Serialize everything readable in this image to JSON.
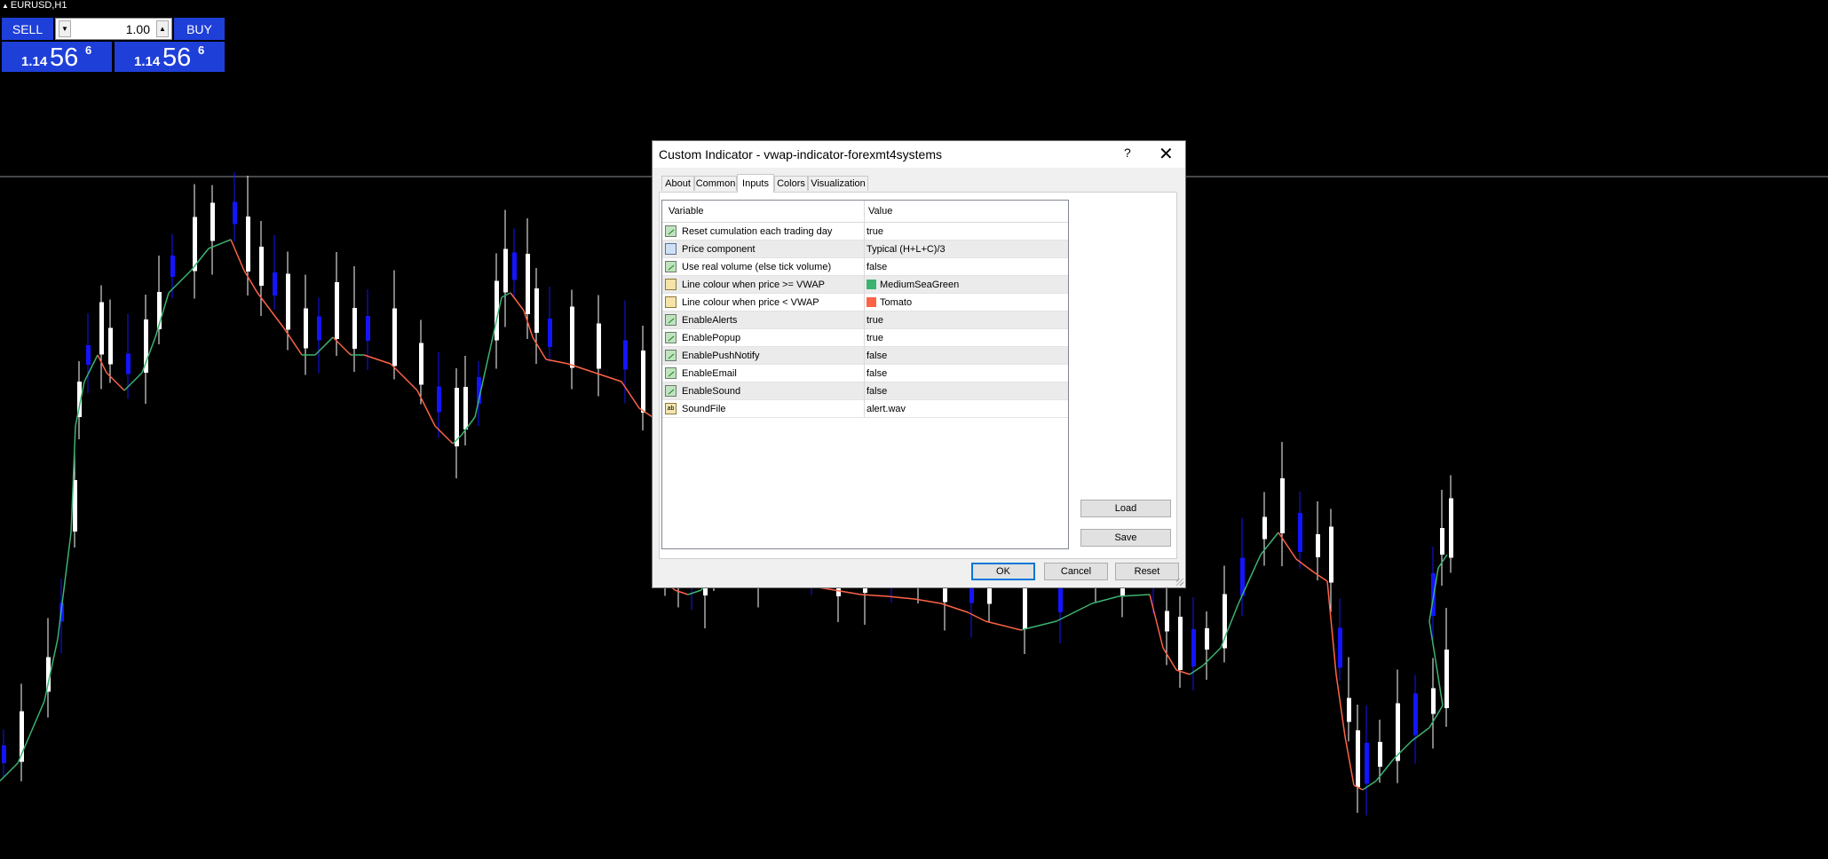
{
  "window": {
    "symbol": "EURUSD,H1"
  },
  "trade_panel": {
    "sell_label": "SELL",
    "buy_label": "BUY",
    "lot_value": "1.00",
    "sell_quote": {
      "small": "1.14",
      "big": "56",
      "sup": "6"
    },
    "buy_quote": {
      "small": "1.14",
      "big": "56",
      "sup": "6"
    }
  },
  "dialog": {
    "title": "Custom Indicator - vwap-indicator-forexmt4systems",
    "help_label": "?",
    "close_label": "✕",
    "tabs": [
      {
        "label": "About"
      },
      {
        "label": "Common"
      },
      {
        "label": "Inputs"
      },
      {
        "label": "Colors"
      },
      {
        "label": "Visualization"
      }
    ],
    "active_tab": "Inputs",
    "columns": {
      "variable": "Variable",
      "value": "Value"
    },
    "rows": [
      {
        "icon": "bool-icon",
        "name": "Reset cumulation each trading day",
        "value": "true"
      },
      {
        "icon": "enum-icon",
        "name": "Price component",
        "value": "Typical (H+L+C)/3"
      },
      {
        "icon": "bool-icon",
        "name": "Use real volume (else tick volume)",
        "value": "false"
      },
      {
        "icon": "color-icon",
        "name": "Line colour when price >= VWAP",
        "value": "MediumSeaGreen",
        "swatch": "#3cb371"
      },
      {
        "icon": "color-icon",
        "name": "Line colour when price <  VWAP",
        "value": "Tomato",
        "swatch": "#ff6347"
      },
      {
        "icon": "bool-icon",
        "name": "EnableAlerts",
        "value": "true"
      },
      {
        "icon": "bool-icon",
        "name": "EnablePopup",
        "value": "true"
      },
      {
        "icon": "bool-icon",
        "name": "EnablePushNotify",
        "value": "false"
      },
      {
        "icon": "bool-icon",
        "name": "EnableEmail",
        "value": "false"
      },
      {
        "icon": "bool-icon",
        "name": "EnableSound",
        "value": "false"
      },
      {
        "icon": "string-icon",
        "name": "SoundFile",
        "value": "alert.wav"
      }
    ],
    "buttons": {
      "load": "Load",
      "save": "Save",
      "ok": "OK",
      "cancel": "Cancel",
      "reset": "Reset"
    }
  },
  "colors": {
    "chart_background": "#000000",
    "bull_candle": "#ffffff",
    "bear_candle": "#1414ff",
    "vwap_above": "#3cb371",
    "vwap_below": "#ff6347",
    "panel_blue": "#1f3fd9"
  }
}
